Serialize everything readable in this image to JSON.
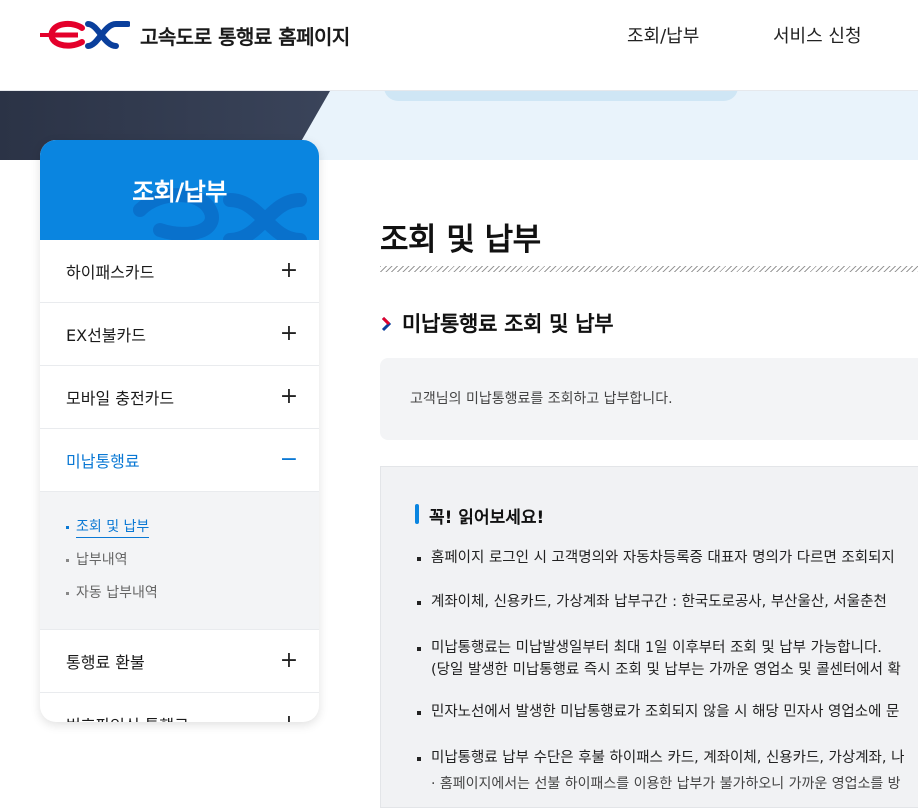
{
  "header": {
    "site_title": "고속도로 통행료 홈페이지",
    "nav": [
      "조회/납부",
      "서비스 신청"
    ]
  },
  "sidebar": {
    "title": "조회/납부",
    "items": [
      {
        "label": "하이패스카드",
        "toggle": "+"
      },
      {
        "label": "EX선불카드",
        "toggle": "+"
      },
      {
        "label": "모바일 충전카드",
        "toggle": "+"
      },
      {
        "label": "미납통행료",
        "toggle": "−"
      },
      {
        "label": "통행료 환불",
        "toggle": "+"
      },
      {
        "label": "번호판인식 통행료",
        "toggle": "+"
      }
    ],
    "sub_items": [
      "조회 및 납부",
      "납부내역",
      "자동 납부내역"
    ]
  },
  "main": {
    "page_title": "조회 및 납부",
    "section_title": "미납통행료 조회 및 납부",
    "description": "고객님의 미납통행료를 조회하고 납부합니다.",
    "notice_title": "꼭! 읽어보세요!",
    "notices": [
      "홈페이지 로그인 시 고객명의와 자동차등록증 대표자 명의가 다르면 조회되지",
      "계좌이체, 신용카드, 가상계좌 납부구간 : 한국도로공사, 부산울산, 서울춘천",
      "미납통행료는 미납발생일부터 최대 1일 이후부터 조회 및 납부 가능합니다.",
      "(당일 발생한 미납통행료 즉시 조회 및 납부는 가까운 영업소 및 콜센터에서 확",
      "민자노선에서 발생한 미납통행료가 조회되지 않을 시 해당 민자사 영업소에 문",
      "미납통행료 납부 수단은 후불 하이패스 카드, 계좌이체, 신용카드, 가상계좌, 나",
      "· 홈페이지에서는 선불 하이패스를 이용한 납부가 불가하오니 가까운 영업소를 방"
    ]
  },
  "colors": {
    "brand_blue": "#0a85e0",
    "brand_red": "#e4002b",
    "active_blue": "#0a78d4"
  }
}
